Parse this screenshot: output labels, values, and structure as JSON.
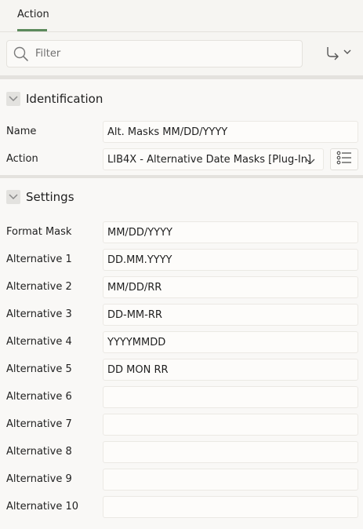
{
  "tabs": [
    {
      "label": "Action"
    }
  ],
  "filter": {
    "placeholder": "Filter"
  },
  "sections": {
    "identification": {
      "title": "Identification",
      "name_label": "Name",
      "name_value": "Alt. Masks MM/DD/YYYY",
      "action_label": "Action",
      "action_value": "LIB4X - Alternative Date Masks [Plug-In]"
    },
    "settings": {
      "title": "Settings",
      "rows": [
        {
          "label": "Format Mask",
          "value": "MM/DD/YYYY"
        },
        {
          "label": "Alternative 1",
          "value": "DD.MM.YYYY"
        },
        {
          "label": "Alternative 2",
          "value": "MM/DD/RR"
        },
        {
          "label": "Alternative 3",
          "value": "DD-MM-RR"
        },
        {
          "label": "Alternative 4",
          "value": "YYYYMMDD"
        },
        {
          "label": "Alternative 5",
          "value": "DD MON RR"
        },
        {
          "label": "Alternative 6",
          "value": ""
        },
        {
          "label": "Alternative 7",
          "value": ""
        },
        {
          "label": "Alternative 8",
          "value": ""
        },
        {
          "label": "Alternative 9",
          "value": ""
        },
        {
          "label": "Alternative 10",
          "value": ""
        }
      ]
    }
  },
  "icons": {
    "search": "search-icon",
    "goto": "goto-arrow-icon",
    "collapse": "chevron-down-icon",
    "list": "list-icon"
  },
  "colors": {
    "tab_underline": "#5c8a5c",
    "background": "#f9f8f6",
    "divider": "#e4e2de"
  }
}
